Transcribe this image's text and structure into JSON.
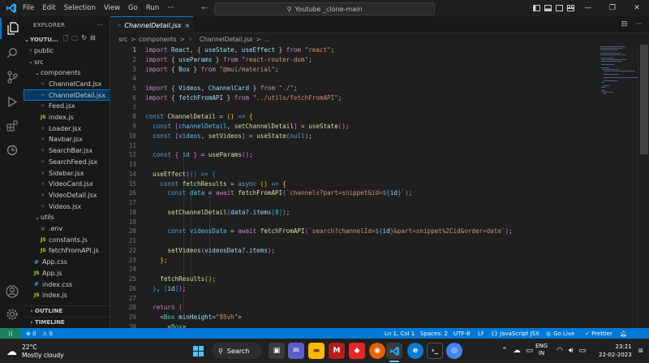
{
  "window": {
    "menu": [
      "File",
      "Edit",
      "Selection",
      "View",
      "Go",
      "Run"
    ],
    "more": "···",
    "search_text": "Youtube _clone-main"
  },
  "explorer": {
    "title": "EXPLORER",
    "root": "YOUTU...",
    "tree": [
      {
        "label": "public",
        "type": "folder",
        "open": false,
        "depth": 0
      },
      {
        "label": "src",
        "type": "folder",
        "open": true,
        "depth": 0
      },
      {
        "label": "components",
        "type": "folder",
        "open": true,
        "depth": 1
      },
      {
        "label": "ChannelCard.jsx",
        "type": "jsx",
        "depth": 2
      },
      {
        "label": "ChannelDetail.jsx",
        "type": "jsx",
        "depth": 2,
        "selected": true
      },
      {
        "label": "Feed.jsx",
        "type": "jsx",
        "depth": 2
      },
      {
        "label": "index.js",
        "type": "js",
        "depth": 2
      },
      {
        "label": "Loader.jsx",
        "type": "jsx",
        "depth": 2
      },
      {
        "label": "Navbar.jsx",
        "type": "jsx",
        "depth": 2
      },
      {
        "label": "SearchBar.jsx",
        "type": "jsx",
        "depth": 2
      },
      {
        "label": "SearchFeed.jsx",
        "type": "jsx",
        "depth": 2
      },
      {
        "label": "Sidebar.jsx",
        "type": "jsx",
        "depth": 2
      },
      {
        "label": "VideoCard.jsx",
        "type": "jsx",
        "depth": 2
      },
      {
        "label": "VideoDetail.jsx",
        "type": "jsx",
        "depth": 2
      },
      {
        "label": "Videos.jsx",
        "type": "jsx",
        "depth": 2
      },
      {
        "label": "utils",
        "type": "folder",
        "open": true,
        "depth": 1
      },
      {
        "label": ".env",
        "type": "env",
        "depth": 2
      },
      {
        "label": "constants.js",
        "type": "js",
        "depth": 2
      },
      {
        "label": "fetchFromAPI.js",
        "type": "js",
        "depth": 2
      },
      {
        "label": "App.css",
        "type": "css",
        "depth": 1
      },
      {
        "label": "App.js",
        "type": "js",
        "depth": 1
      },
      {
        "label": "index.css",
        "type": "css",
        "depth": 1
      },
      {
        "label": "index.js",
        "type": "js",
        "depth": 1
      }
    ],
    "outline": "OUTLINE",
    "timeline": "TIMELINE"
  },
  "tab": {
    "label": "ChannelDetail.jsx",
    "close": "×",
    "split": "⊟",
    "more": "···"
  },
  "breadcrumb": [
    "src",
    ">",
    "components",
    ">",
    "ChannelDetail.jsx",
    ">",
    "..."
  ],
  "editor": {
    "current_line": 1,
    "lines": [
      [
        [
          "import ",
          "k"
        ],
        [
          "React",
          "v"
        ],
        [
          ", { ",
          "w"
        ],
        [
          "useState",
          "v"
        ],
        [
          ", ",
          "w"
        ],
        [
          "useEffect",
          "v"
        ],
        [
          " } ",
          "w"
        ],
        [
          "from ",
          "k"
        ],
        [
          "\"react\"",
          "s"
        ],
        [
          ";",
          "w"
        ]
      ],
      [
        [
          "import ",
          "k"
        ],
        [
          "{ ",
          "w"
        ],
        [
          "useParams",
          "v"
        ],
        [
          " } ",
          "w"
        ],
        [
          "from ",
          "k"
        ],
        [
          "\"react-router-dom\"",
          "s"
        ],
        [
          ";",
          "w"
        ]
      ],
      [
        [
          "import ",
          "k"
        ],
        [
          "{ ",
          "w"
        ],
        [
          "Box",
          "v"
        ],
        [
          " } ",
          "w"
        ],
        [
          "from ",
          "k"
        ],
        [
          "\"@mui/material\"",
          "s"
        ],
        [
          ";",
          "w"
        ]
      ],
      [],
      [
        [
          "import ",
          "k"
        ],
        [
          "{ ",
          "w"
        ],
        [
          "Videos",
          "v"
        ],
        [
          ", ",
          "w"
        ],
        [
          "ChannelCard",
          "v"
        ],
        [
          " } ",
          "w"
        ],
        [
          "from ",
          "k"
        ],
        [
          "\"./\"",
          "s"
        ],
        [
          ";",
          "w"
        ]
      ],
      [
        [
          "import ",
          "k"
        ],
        [
          "{ ",
          "w"
        ],
        [
          "fetchFromAPI",
          "v"
        ],
        [
          " } ",
          "w"
        ],
        [
          "from ",
          "k"
        ],
        [
          "\"../utils/fetchFromAPI\"",
          "s"
        ],
        [
          ";",
          "w"
        ]
      ],
      [],
      [
        [
          "const ",
          "kw"
        ],
        [
          "ChannelDetail",
          "f"
        ],
        [
          " = ",
          "w"
        ],
        [
          "()",
          "p"
        ],
        [
          " => ",
          "kw"
        ],
        [
          "{",
          "p"
        ]
      ],
      [
        [
          "  const ",
          "kw"
        ],
        [
          "[",
          "p2"
        ],
        [
          "channelDetail",
          "c"
        ],
        [
          ", ",
          "w"
        ],
        [
          "setChannelDetail",
          "f"
        ],
        [
          "]",
          "p2"
        ],
        [
          " = ",
          "w"
        ],
        [
          "useState",
          "f"
        ],
        [
          "()",
          "p2"
        ],
        [
          ";",
          "w"
        ]
      ],
      [
        [
          "  const ",
          "kw"
        ],
        [
          "[",
          "p2"
        ],
        [
          "videos",
          "c"
        ],
        [
          ", ",
          "w"
        ],
        [
          "setVideos",
          "f"
        ],
        [
          "]",
          "p2"
        ],
        [
          " = ",
          "w"
        ],
        [
          "useState",
          "f"
        ],
        [
          "(",
          "p2"
        ],
        [
          "null",
          "kw"
        ],
        [
          ")",
          "p2"
        ],
        [
          ";",
          "w"
        ]
      ],
      [],
      [
        [
          "  const ",
          "kw"
        ],
        [
          "{ ",
          "p2"
        ],
        [
          "id",
          "c"
        ],
        [
          " }",
          "p2"
        ],
        [
          " = ",
          "w"
        ],
        [
          "useParams",
          "f"
        ],
        [
          "()",
          "p2"
        ],
        [
          ";",
          "w"
        ]
      ],
      [],
      [
        [
          "  useEffect",
          "f"
        ],
        [
          "(",
          "p2"
        ],
        [
          "()",
          "p3"
        ],
        [
          " => ",
          "kw"
        ],
        [
          "{",
          "p3"
        ]
      ],
      [
        [
          "    const ",
          "kw"
        ],
        [
          "fetchResults",
          "f"
        ],
        [
          " = ",
          "w"
        ],
        [
          "async ",
          "kw"
        ],
        [
          "()",
          "p"
        ],
        [
          " => ",
          "kw"
        ],
        [
          "{",
          "p"
        ]
      ],
      [
        [
          "      const ",
          "kw"
        ],
        [
          "data",
          "c"
        ],
        [
          " = ",
          "w"
        ],
        [
          "await ",
          "k"
        ],
        [
          "fetchFromAPI",
          "f"
        ],
        [
          "(",
          "p2"
        ],
        [
          "`channels?part=snippet&id=",
          "s"
        ],
        [
          "${",
          "kw"
        ],
        [
          "id",
          "v"
        ],
        [
          "}",
          "kw"
        ],
        [
          "`",
          "s"
        ],
        [
          ")",
          "p2"
        ],
        [
          ";",
          "w"
        ]
      ],
      [],
      [
        [
          "      setChannelDetail",
          "f"
        ],
        [
          "(",
          "p2"
        ],
        [
          "data",
          "v"
        ],
        [
          "?.",
          "w"
        ],
        [
          "items",
          "v"
        ],
        [
          "[",
          "p3"
        ],
        [
          "0",
          "t"
        ],
        [
          "]",
          "p3"
        ],
        [
          ")",
          "p2"
        ],
        [
          ";",
          "w"
        ]
      ],
      [],
      [
        [
          "      const ",
          "kw"
        ],
        [
          "videosData",
          "c"
        ],
        [
          " = ",
          "w"
        ],
        [
          "await ",
          "k"
        ],
        [
          "fetchFromAPI",
          "f"
        ],
        [
          "(",
          "p2"
        ],
        [
          "`search?channelId=",
          "s"
        ],
        [
          "${",
          "kw"
        ],
        [
          "id",
          "v"
        ],
        [
          "}",
          "kw"
        ],
        [
          "&part=snippet%2Cid&order=date`",
          "s"
        ],
        [
          ")",
          "p2"
        ],
        [
          ";",
          "w"
        ]
      ],
      [],
      [
        [
          "      setVideos",
          "f"
        ],
        [
          "(",
          "p2"
        ],
        [
          "videosData",
          "v"
        ],
        [
          "?.",
          "w"
        ],
        [
          "items",
          "v"
        ],
        [
          ")",
          "p2"
        ],
        [
          ";",
          "w"
        ]
      ],
      [
        [
          "    }",
          "p"
        ],
        [
          ";",
          "w"
        ]
      ],
      [],
      [
        [
          "    fetchResults",
          "f"
        ],
        [
          "()",
          "p"
        ],
        [
          ";",
          "w"
        ]
      ],
      [
        [
          "  }",
          "p3"
        ],
        [
          ", ",
          "w"
        ],
        [
          "[",
          "p3"
        ],
        [
          "id",
          "v"
        ],
        [
          "]",
          "p3"
        ],
        [
          ")",
          "p2"
        ],
        [
          ";",
          "w"
        ]
      ],
      [],
      [
        [
          "  return ",
          "k"
        ],
        [
          "(",
          "p2"
        ]
      ],
      [
        [
          "    <",
          "w"
        ],
        [
          "Box ",
          "t"
        ],
        [
          "minHeight",
          "v"
        ],
        [
          "=",
          "w"
        ],
        [
          "\"95vh\"",
          "s"
        ],
        [
          ">",
          "w"
        ]
      ],
      [
        [
          "      <",
          "w"
        ],
        [
          "Box",
          "t"
        ],
        [
          ">",
          "w"
        ]
      ]
    ]
  },
  "status": {
    "errors": "⊗ 0",
    "warnings": "⚠ 0",
    "position": "Ln 1, Col 1",
    "spaces": "Spaces: 2",
    "encoding": "UTF-8",
    "eol": "LF",
    "language": "{} JavaScript JSX",
    "golive": "Go Live",
    "prettier": "✓ Prettier"
  },
  "taskbar": {
    "temp": "22°C",
    "weather": "Mostly cloudy",
    "search": "Search",
    "lang1": "ENG",
    "lang2": "IN",
    "time": "23:21",
    "date": "22-02-2023"
  }
}
